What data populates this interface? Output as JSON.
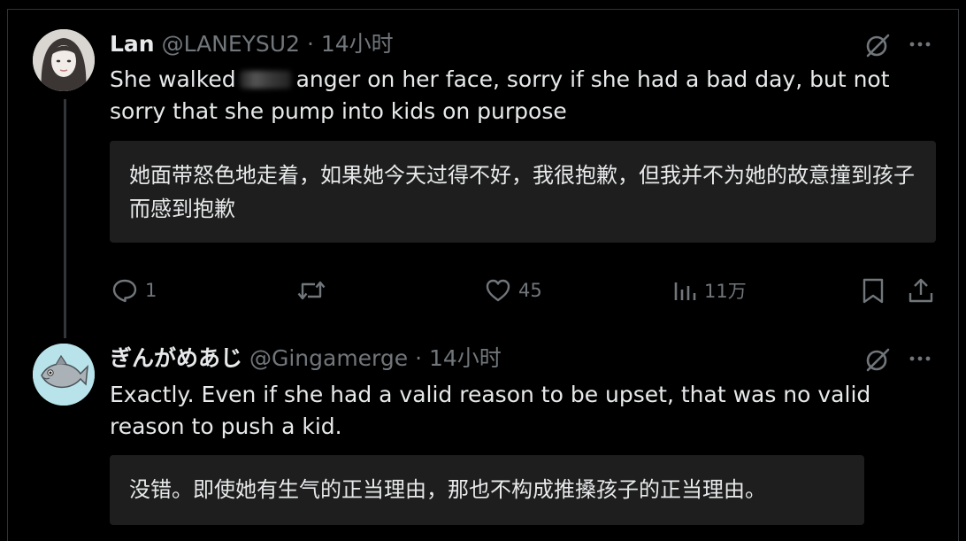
{
  "tweet1": {
    "name": "Lan",
    "handle": "@LANEYSU2",
    "separator": " · ",
    "time": "14小时",
    "text_before": "She walked",
    "text_after": "anger on her face, sorry if she had a bad day, but not sorry that she pump into kids on purpose",
    "translation": "她面带怒色地走着，如果她今天过得不好，我很抱歉，但我并不为她的故意撞到孩子而感到抱歉",
    "actions": {
      "replies": "1",
      "likes": "45",
      "views": "11万"
    }
  },
  "tweet2": {
    "name": "ぎんがめあじ",
    "handle": "@Gingamerge",
    "separator": " · ",
    "time": "14小时",
    "text": "Exactly. Even if she had a valid reason to be upset, that was no valid reason to push a kid.",
    "translation": "没错。即使她有生气的正当理由，那也不构成推搡孩子的正当理由。"
  },
  "icons": {
    "grok": "grok-icon",
    "more": "more-icon",
    "reply": "reply-icon",
    "retweet": "retweet-icon",
    "like": "heart-icon",
    "views": "views-icon",
    "bookmark": "bookmark-icon",
    "share": "share-icon"
  },
  "colors": {
    "background": "#000000",
    "text": "#e7e9ea",
    "muted": "#71767b",
    "translation_box": "#1e1e1e"
  }
}
